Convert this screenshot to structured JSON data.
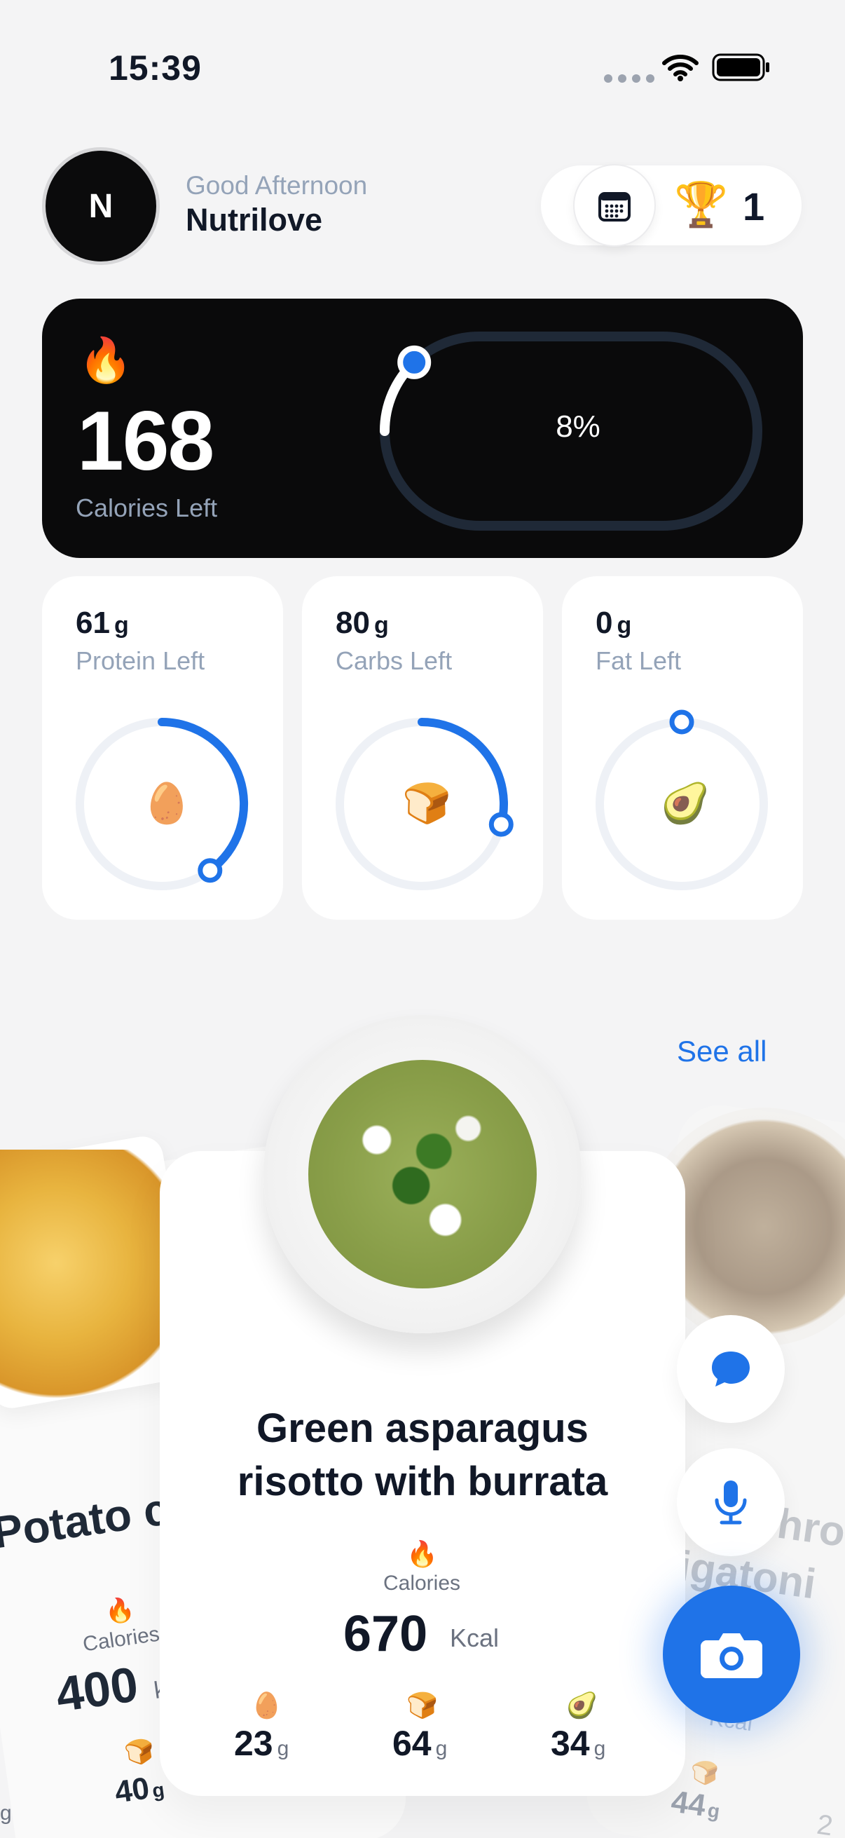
{
  "status_bar": {
    "time": "15:39"
  },
  "header": {
    "avatar_initial": "N",
    "greeting": "Good Afternoon",
    "user_name": "Nutrilove",
    "streak_count": "1",
    "icons": {
      "calendar": "calendar-icon",
      "trophy": "trophy-icon"
    }
  },
  "calories": {
    "icon": "🔥",
    "value": "168",
    "label": "Calories Left",
    "progress_percent_text": "8%",
    "progress_fraction": 0.08
  },
  "macros": [
    {
      "value": "61",
      "unit": "g",
      "label": "Protein Left",
      "emoji": "🥚",
      "progress_fraction": 0.4
    },
    {
      "value": "80",
      "unit": "g",
      "label": "Carbs Left",
      "emoji": "🍞",
      "progress_fraction": 0.29
    },
    {
      "value": "0",
      "unit": "g",
      "label": "Fat Left",
      "emoji": "🥑",
      "progress_fraction": 0.0
    }
  ],
  "recipes": {
    "see_all_label": "See all",
    "featured": {
      "title_line1": "Green asparagus",
      "title_line2": "risotto with burrata",
      "calories_icon": "🔥",
      "calories_label": "Calories",
      "kcal_value": "670",
      "kcal_unit": "Kcal",
      "macros": [
        {
          "emoji": "🥚",
          "value": "23",
          "unit": "g"
        },
        {
          "emoji": "🍞",
          "value": "64",
          "unit": "g"
        },
        {
          "emoji": "🥑",
          "value": "34",
          "unit": "g"
        }
      ]
    },
    "left_partial": {
      "title": "Potato ch",
      "calories_icon": "🔥",
      "calories_label": "Calories",
      "kcal_value": "400",
      "kcal_unit": "k",
      "carbs_emoji": "🍞",
      "carbs_value": "40",
      "carbs_unit": "g",
      "trailing_unit": "g"
    },
    "right_partial": {
      "title_line1": "ushro",
      "title_line2": "igatoni",
      "kcal_unit": "Kcal",
      "bread_emoji": "🍞",
      "value": "44",
      "unit": "g",
      "trailing": "2"
    }
  },
  "actions": {
    "chat": "chat-bubble-icon",
    "voice": "microphone-icon",
    "camera": "camera-icon"
  },
  "colors": {
    "accent": "#1f73e8",
    "background": "#f4f4f5",
    "card_dark": "#0a0a0b",
    "ring_track_dark": "#1f2937",
    "ring_track_light": "#eef1f6"
  }
}
